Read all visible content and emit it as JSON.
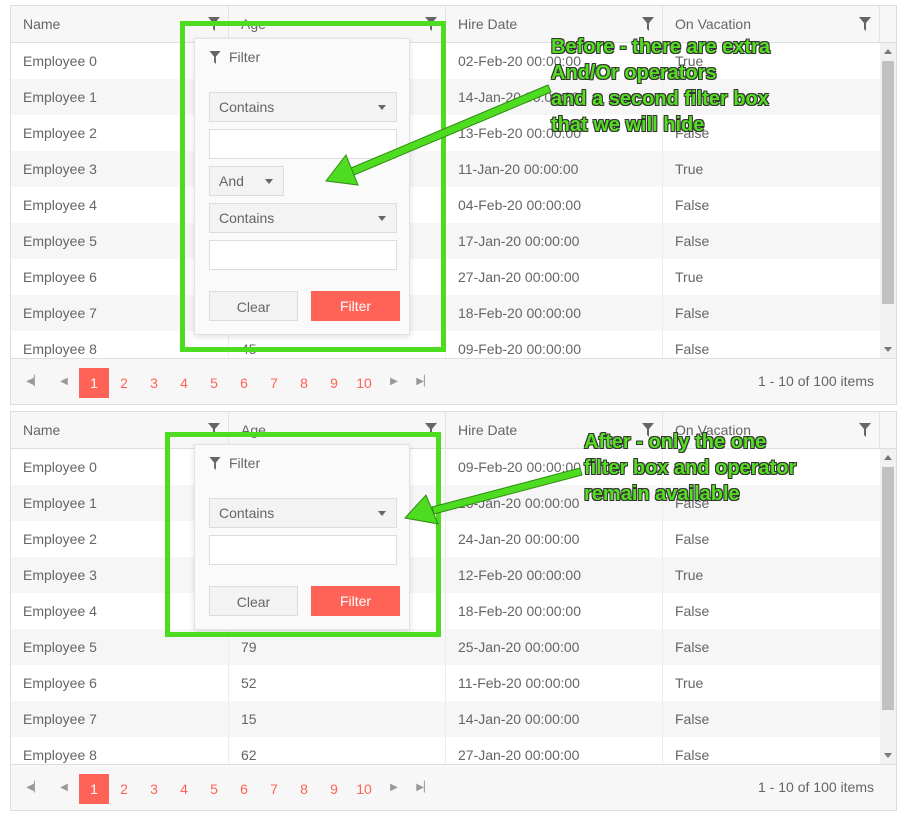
{
  "columns": [
    "Name",
    "Age",
    "Hire Date",
    "On Vacation"
  ],
  "top_grid": {
    "rows": [
      {
        "name": "Employee 0",
        "age": "",
        "hire": "02-Feb-20 00:00:00",
        "vac": "True"
      },
      {
        "name": "Employee 1",
        "age": "",
        "hire": "14-Jan-20 00:00:00",
        "vac": ""
      },
      {
        "name": "Employee 2",
        "age": "",
        "hire": "13-Feb-20 00:00:00",
        "vac": "False"
      },
      {
        "name": "Employee 3",
        "age": "",
        "hire": "11-Jan-20 00:00:00",
        "vac": "True"
      },
      {
        "name": "Employee 4",
        "age": "",
        "hire": "04-Feb-20 00:00:00",
        "vac": "False"
      },
      {
        "name": "Employee 5",
        "age": "",
        "hire": "17-Jan-20 00:00:00",
        "vac": "False"
      },
      {
        "name": "Employee 6",
        "age": "",
        "hire": "27-Jan-20 00:00:00",
        "vac": "True"
      },
      {
        "name": "Employee 7",
        "age": "",
        "hire": "18-Feb-20 00:00:00",
        "vac": "False"
      },
      {
        "name": "Employee 8",
        "age": "45",
        "hire": "09-Feb-20 00:00:00",
        "vac": "False"
      }
    ],
    "filter": {
      "title": "Filter",
      "operator1": "Contains",
      "logic": "And",
      "operator2": "Contains",
      "clear_label": "Clear",
      "filter_label": "Filter"
    },
    "annotation": [
      "Before - there are extra",
      "And/Or operators",
      "and a second filter box",
      "that we will hide"
    ]
  },
  "bottom_grid": {
    "rows": [
      {
        "name": "Employee 0",
        "age": "",
        "hire": "09-Feb-20 00:00:00",
        "vac": ""
      },
      {
        "name": "Employee 1",
        "age": "",
        "hire": "16-Jan-20 00:00:00",
        "vac": "False"
      },
      {
        "name": "Employee 2",
        "age": "",
        "hire": "24-Jan-20 00:00:00",
        "vac": "False"
      },
      {
        "name": "Employee 3",
        "age": "",
        "hire": "12-Feb-20 00:00:00",
        "vac": "True"
      },
      {
        "name": "Employee 4",
        "age": "",
        "hire": "18-Feb-20 00:00:00",
        "vac": "False"
      },
      {
        "name": "Employee 5",
        "age": "79",
        "hire": "25-Jan-20 00:00:00",
        "vac": "False"
      },
      {
        "name": "Employee 6",
        "age": "52",
        "hire": "11-Feb-20 00:00:00",
        "vac": "True"
      },
      {
        "name": "Employee 7",
        "age": "15",
        "hire": "14-Jan-20 00:00:00",
        "vac": "False"
      },
      {
        "name": "Employee 8",
        "age": "62",
        "hire": "27-Jan-20 00:00:00",
        "vac": "False"
      }
    ],
    "filter": {
      "title": "Filter",
      "operator1": "Contains",
      "clear_label": "Clear",
      "filter_label": "Filter"
    },
    "annotation": [
      "After - only the one",
      "filter box and operator",
      "remain available"
    ]
  },
  "pager": {
    "pages": [
      "1",
      "2",
      "3",
      "4",
      "5",
      "6",
      "7",
      "8",
      "9",
      "10"
    ],
    "active_page": "1",
    "info": "1 - 10 of 100 items",
    "first_icon": "seek-first-icon",
    "prev_icon": "arrow-left-icon",
    "next_icon": "arrow-right-icon",
    "last_icon": "seek-last-icon"
  },
  "colors": {
    "accent": "#ff6358",
    "highlight": "#4ddc1f",
    "annotation_text": "#55dd22"
  }
}
